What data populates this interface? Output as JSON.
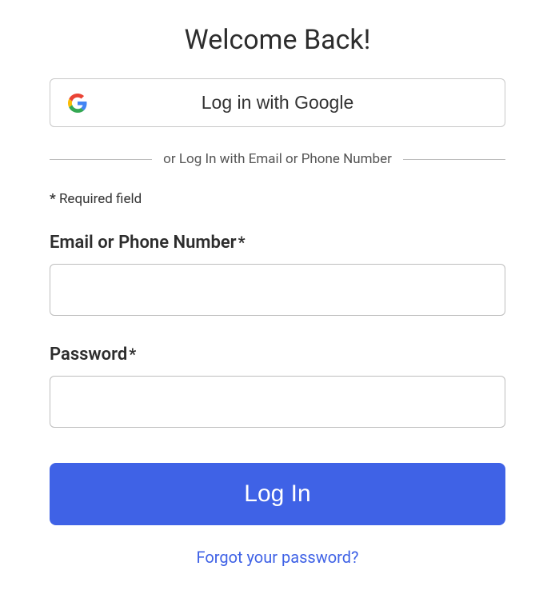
{
  "title": "Welcome Back!",
  "google_button": {
    "label": "Log in with Google"
  },
  "divider_text": "or Log In with Email or Phone Number",
  "required_star": "*",
  "required_note": "Required field",
  "fields": {
    "email": {
      "label": "Email or Phone Number",
      "value": ""
    },
    "password": {
      "label": "Password",
      "value": ""
    }
  },
  "login_button_label": "Log In",
  "forgot_password_label": "Forgot your password?",
  "colors": {
    "primary": "#3f62e6",
    "border": "#bdbdbd",
    "text": "#2d2d2d"
  }
}
